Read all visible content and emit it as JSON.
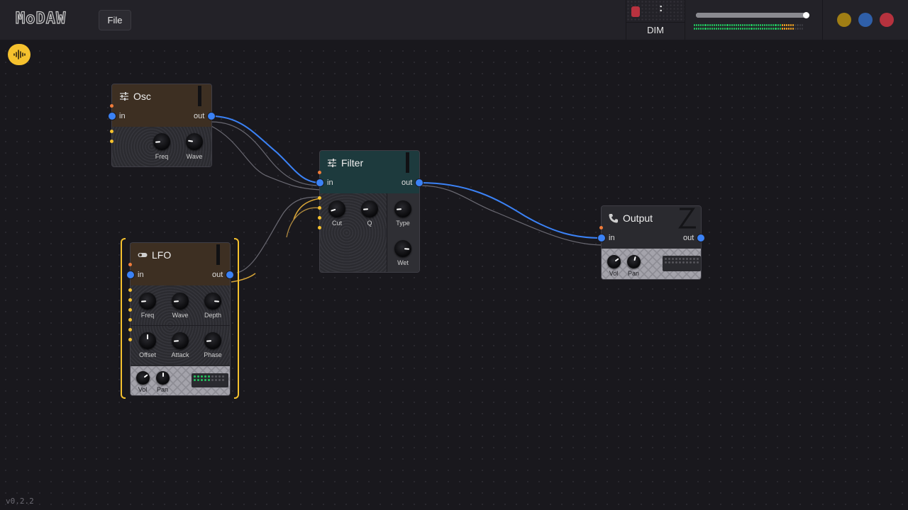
{
  "app": {
    "logo": "MoDAW",
    "version": "v0.2.2"
  },
  "menu": {
    "file_label": "File"
  },
  "transport": {
    "dim_label": "DIM",
    "record_color": "#b8323f",
    "volume_percent": 97
  },
  "window_controls": {
    "colors": [
      "#a07e14",
      "#2f5fa8",
      "#b6323e"
    ]
  },
  "toolbar": {
    "waveform_icon": "waveform-icon",
    "accent": "#f5c12e"
  },
  "nodes": {
    "osc": {
      "title": "Osc",
      "icon": "sliders-icon",
      "in_label": "in",
      "out_label": "out",
      "knobs": [
        {
          "label": "Freq",
          "value": 0.15
        },
        {
          "label": "Wave",
          "value": 0.2
        }
      ]
    },
    "filter": {
      "title": "Filter",
      "icon": "sliders-icon",
      "in_label": "in",
      "out_label": "out",
      "knobs": [
        {
          "label": "Cut",
          "value": 0.1
        },
        {
          "label": "Q",
          "value": 0.15
        },
        {
          "label": "Type",
          "value": 0.15
        },
        {
          "label": "Wet",
          "value": 0.85
        }
      ]
    },
    "lfo": {
      "title": "LFO",
      "icon": "toggle-icon",
      "in_label": "in",
      "out_label": "out",
      "knobs": [
        {
          "label": "Freq",
          "value": 0.15
        },
        {
          "label": "Wave",
          "value": 0.15
        },
        {
          "label": "Depth",
          "value": 0.85
        },
        {
          "label": "Offset",
          "value": 0.5
        },
        {
          "label": "Attack",
          "value": 0.15
        },
        {
          "label": "Phase",
          "value": 0.15
        }
      ],
      "mixer": [
        {
          "label": "Vol",
          "value": 0.7
        },
        {
          "label": "Pan",
          "value": 0.5
        }
      ]
    },
    "output": {
      "title": "Output",
      "icon": "phone-icon",
      "in_label": "in",
      "out_label": "out",
      "mixer": [
        {
          "label": "Vol",
          "value": 0.7
        },
        {
          "label": "Pan",
          "value": 0.55
        }
      ]
    }
  },
  "colors": {
    "cable_audio": "#3b82f6",
    "cable_mod": "#d6a437",
    "osc_header": "#3d2f22",
    "filter_header": "#1d3a3d",
    "lfo_header": "#3d2f22",
    "output_header": "#2a2a2f",
    "led_green": "#22c55e",
    "led_orange": "#f5a623"
  }
}
